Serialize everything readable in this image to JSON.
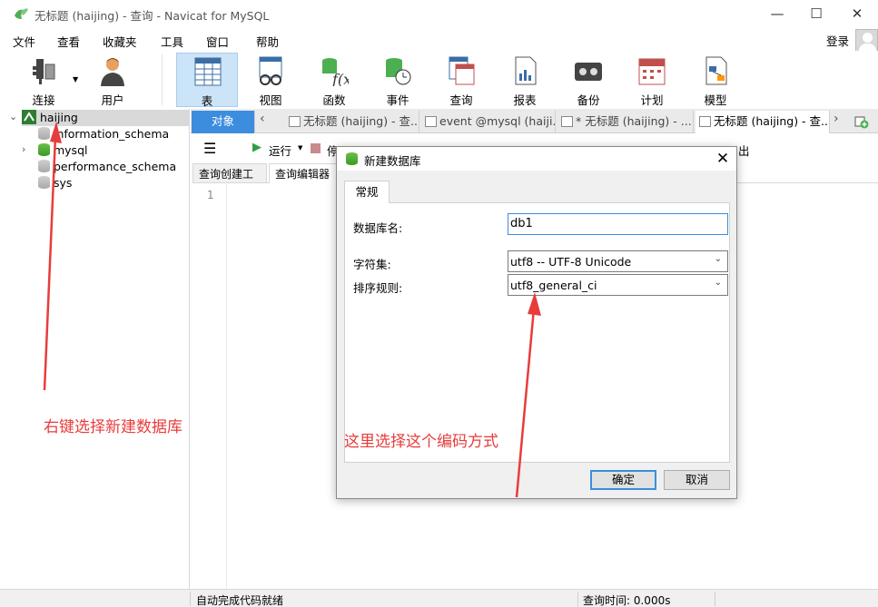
{
  "window": {
    "title": "无标题 (haijing) - 查询 - Navicat for MySQL",
    "controls": [
      "—",
      "☐",
      "✕"
    ]
  },
  "menu": [
    "文件",
    "查看",
    "收藏夹",
    "工具",
    "窗口",
    "帮助"
  ],
  "login_label": "登录",
  "toolbar": {
    "connect": "连接",
    "user": "用户",
    "table": "表",
    "view": "视图",
    "function": "函数",
    "event": "事件",
    "query": "查询",
    "report": "报表",
    "backup": "备份",
    "schedule": "计划",
    "model": "模型"
  },
  "nav": {
    "connection": "haijing",
    "databases": [
      "information_schema",
      "mysql",
      "performance_schema",
      "sys"
    ]
  },
  "tabs": {
    "objects": "对象",
    "tab1": "无标题 (haijing) - 查...",
    "tab2": "event @mysql (haiji...",
    "tab3": "* 无标题 (haijing) - ...",
    "tab4": "无标题 (haijing) - 查..."
  },
  "query_toolbar": {
    "run": "运行",
    "stop": "停",
    "export": "出"
  },
  "subtabs": {
    "builder": "查询创建工具",
    "editor": "查询编辑器"
  },
  "editor": {
    "line1": "1"
  },
  "status": {
    "left": "自动完成代码就绪",
    "query_time": "查询时间: 0.000s"
  },
  "dialog": {
    "title": "新建数据库",
    "tab_general": "常规",
    "db_name_label": "数据库名:",
    "db_name_value": "db1",
    "charset_label": "字符集:",
    "charset_value": "utf8 -- UTF-8 Unicode",
    "collation_label": "排序规则:",
    "collation_value": "utf8_general_ci",
    "ok": "确定",
    "cancel": "取消"
  },
  "annotations": {
    "left_note": "右键选择新建数据库",
    "right_note": "这里选择这个编码方式",
    "color": "#e83c3c"
  }
}
